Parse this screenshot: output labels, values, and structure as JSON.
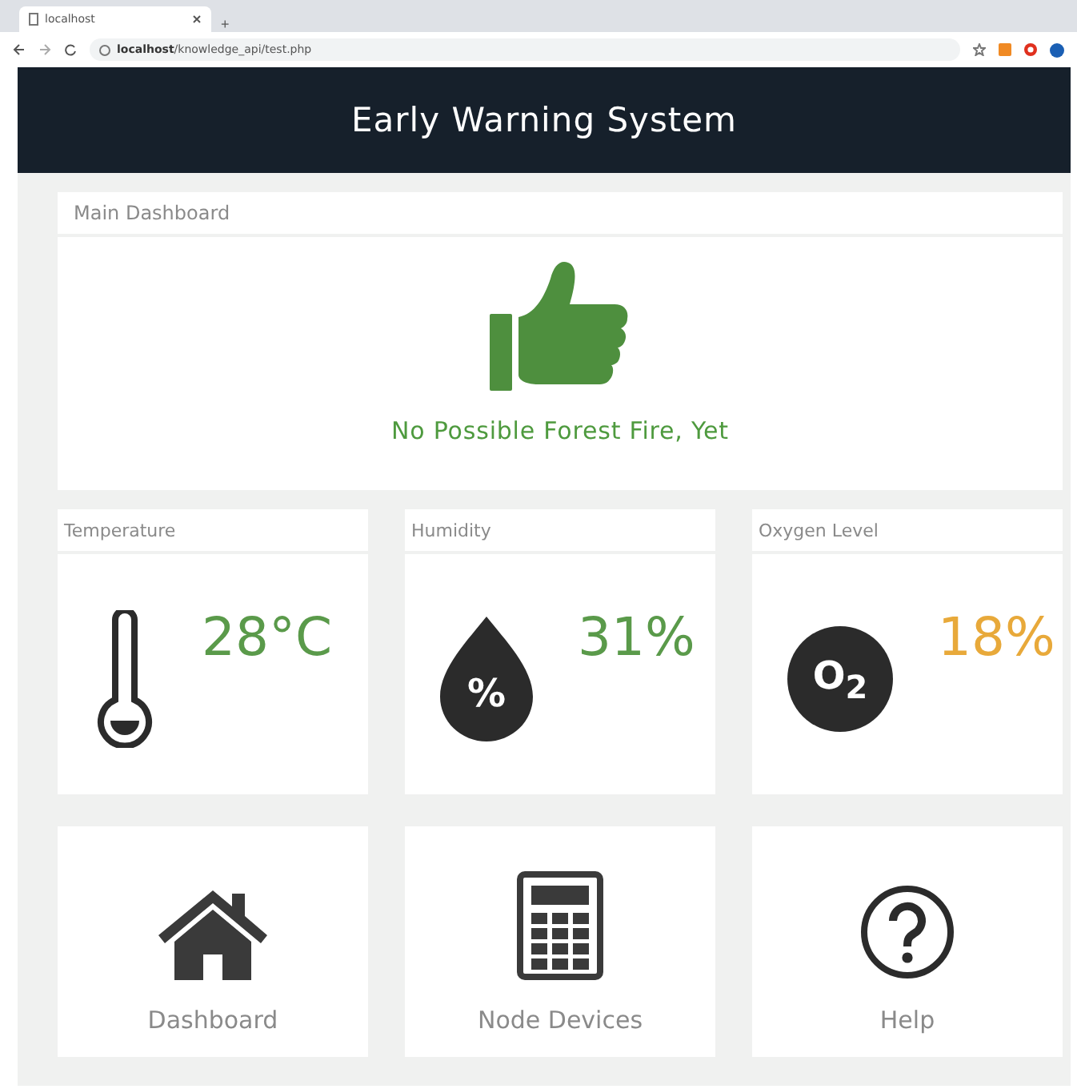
{
  "browser": {
    "tab_title": "localhost",
    "new_tab": "+",
    "url_host": "localhost",
    "url_path": "/knowledge_api/test.php"
  },
  "header": {
    "title": "Early Warning System"
  },
  "main_card": {
    "title": "Main Dashboard",
    "status": "No Possible Forest Fire, Yet"
  },
  "sensors": [
    {
      "kind": "temperature",
      "title": "Temperature",
      "value": "28°C",
      "color": "#5a9a4a"
    },
    {
      "kind": "humidity",
      "title": "Humidity",
      "value": "31%",
      "color": "#5a9a4a",
      "icon_label": "%"
    },
    {
      "kind": "oxygen",
      "title": "Oxygen Level",
      "value": "18%",
      "color": "#e8a93a",
      "icon_label": "O$_{2}$"
    }
  ],
  "nav": [
    {
      "kind": "home",
      "label": "Dashboard"
    },
    {
      "kind": "calculator",
      "label": "Node Devices"
    },
    {
      "kind": "help",
      "label": "Help"
    }
  ]
}
